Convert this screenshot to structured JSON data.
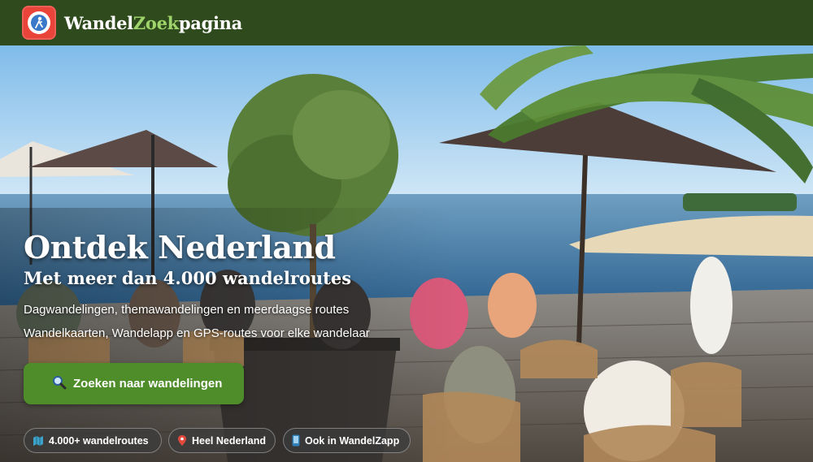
{
  "header": {
    "brand_part1": "Wandel",
    "brand_part2": "Zoek",
    "brand_part3": "pagina",
    "logo_icon": "walker-icon",
    "background_color": "#2f4a1c",
    "accent_color": "#9fd36b"
  },
  "hero": {
    "title": "Ontdek Nederland",
    "subtitle": "Met meer dan 4.000 wandelroutes",
    "line1": "Dagwandelingen, themawandelingen en meerdaagse routes",
    "line2": "Wandelkaarten, Wandelapp en GPS-routes voor elke wandelaar",
    "search_button": {
      "label": "Zoeken naar wandelingen",
      "icon": "search-icon",
      "color": "#4f8d2a"
    },
    "badges": [
      {
        "label": "4.000+ wandelroutes",
        "icon": "map-icon"
      },
      {
        "label": "Heel Nederland",
        "icon": "pin-icon"
      },
      {
        "label": "Ook in WandelZapp",
        "icon": "phone-icon"
      }
    ]
  }
}
